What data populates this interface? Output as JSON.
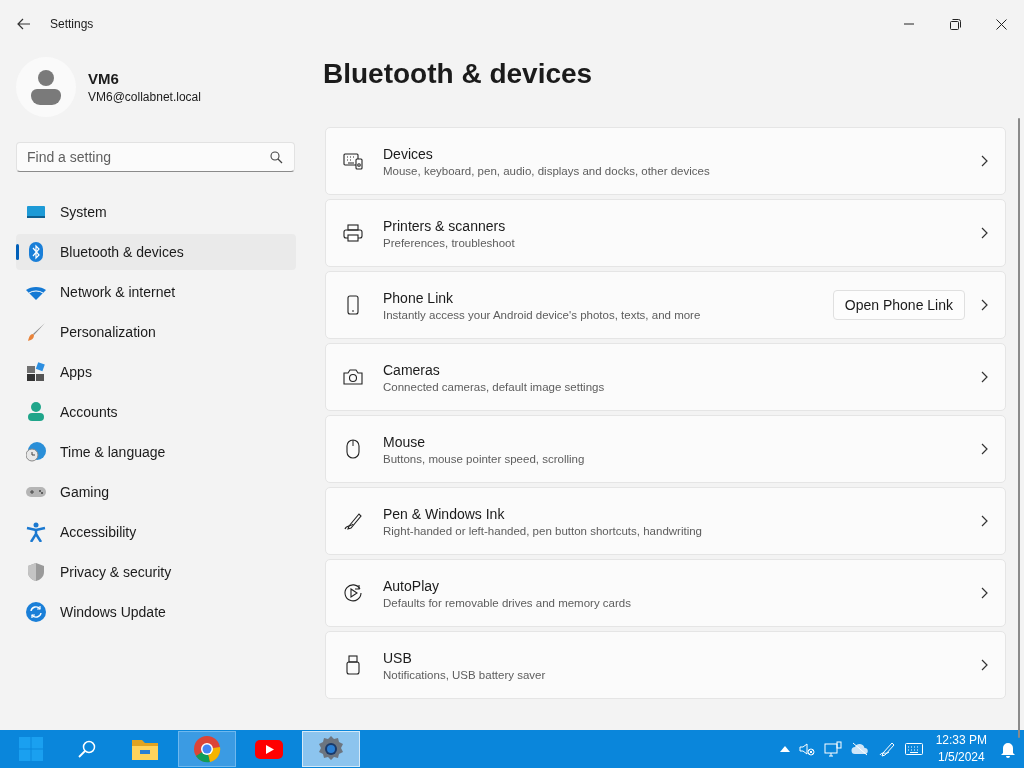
{
  "window": {
    "title": "Settings"
  },
  "profile": {
    "name": "VM6",
    "email": "VM6@collabnet.local"
  },
  "search": {
    "placeholder": "Find a setting"
  },
  "sidebar": {
    "items": [
      {
        "label": "System",
        "selected": false
      },
      {
        "label": "Bluetooth & devices",
        "selected": true
      },
      {
        "label": "Network & internet",
        "selected": false
      },
      {
        "label": "Personalization",
        "selected": false
      },
      {
        "label": "Apps",
        "selected": false
      },
      {
        "label": "Accounts",
        "selected": false
      },
      {
        "label": "Time & language",
        "selected": false
      },
      {
        "label": "Gaming",
        "selected": false
      },
      {
        "label": "Accessibility",
        "selected": false
      },
      {
        "label": "Privacy & security",
        "selected": false
      },
      {
        "label": "Windows Update",
        "selected": false
      }
    ]
  },
  "page": {
    "title": "Bluetooth & devices",
    "cards": [
      {
        "title": "Devices",
        "subtitle": "Mouse, keyboard, pen, audio, displays and docks, other devices"
      },
      {
        "title": "Printers & scanners",
        "subtitle": "Preferences, troubleshoot"
      },
      {
        "title": "Phone Link",
        "subtitle": "Instantly access your Android device's photos, texts, and more",
        "action": "Open Phone Link"
      },
      {
        "title": "Cameras",
        "subtitle": "Connected cameras, default image settings"
      },
      {
        "title": "Mouse",
        "subtitle": "Buttons, mouse pointer speed, scrolling"
      },
      {
        "title": "Pen & Windows Ink",
        "subtitle": "Right-handed or left-handed, pen button shortcuts, handwriting"
      },
      {
        "title": "AutoPlay",
        "subtitle": "Defaults for removable drives and memory cards"
      },
      {
        "title": "USB",
        "subtitle": "Notifications, USB battery saver"
      }
    ]
  },
  "taskbar": {
    "apps": [
      {
        "kind": "folder",
        "running": false,
        "selected": false
      },
      {
        "kind": "chrome",
        "running": true,
        "selected": false
      },
      {
        "kind": "youtube",
        "running": false,
        "selected": false
      },
      {
        "kind": "settings",
        "running": true,
        "selected": true
      }
    ],
    "time": "12:33 PM",
    "date": "1/5/2024"
  }
}
